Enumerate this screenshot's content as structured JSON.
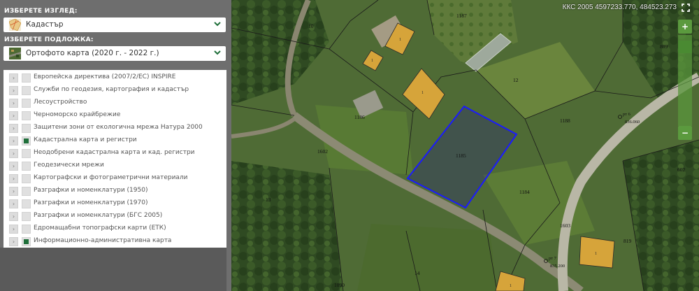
{
  "sidebar": {
    "view_label": "ИЗБЕРЕТЕ ИЗГЛЕД:",
    "view_value": "Кадастър",
    "base_label": "ИЗБЕРЕТЕ ПОДЛОЖКА:",
    "base_value": "Ортофото карта (2020 г. - 2022 г.)",
    "layers": [
      {
        "label": "Европейска директива (2007/2/ЕС) INSPIRE",
        "checked": false
      },
      {
        "label": "Служби по геодезия, картография и кадастър",
        "checked": false
      },
      {
        "label": "Лесоустройство",
        "checked": false
      },
      {
        "label": "Черноморско крайбрежие",
        "checked": false
      },
      {
        "label": "Защитени зони от екологична мрежа Натура 2000",
        "checked": false
      },
      {
        "label": "Кадастрална карта и регистри",
        "checked": true
      },
      {
        "label": "Неодобрени кадастрална карта и кад. регистри",
        "checked": false
      },
      {
        "label": "Геодезически мрежи",
        "checked": false
      },
      {
        "label": "Картографски и фотограметрични материали",
        "checked": false
      },
      {
        "label": "Разграфки и номенклатури (1950)",
        "checked": false
      },
      {
        "label": "Разграфки и номенклатури (1970)",
        "checked": false
      },
      {
        "label": "Разграфки и номенклатури (БГС 2005)",
        "checked": false
      },
      {
        "label": "Едромащабни топографски карти (ЕТК)",
        "checked": false
      },
      {
        "label": "Информационно-административна карта",
        "checked": true
      }
    ]
  },
  "map": {
    "coords": "ККС 2005 4597233.770, 484523.273",
    "zoom_in": "+",
    "zoom_out": "−",
    "parcels": [
      "1187",
      "10",
      "12",
      "1188",
      "809",
      "1186",
      "1602",
      "1185",
      "1184",
      "602",
      "13",
      "1603",
      "819",
      "14",
      "1090"
    ],
    "benchmarks": [
      {
        "id": "рт 6",
        "value": "836.060"
      },
      {
        "id": "рт 7",
        "value": "835.200"
      }
    ],
    "building_labels": [
      "1",
      "1",
      "1",
      "1",
      "1"
    ],
    "accent": "#1f6f3a",
    "parcel_outline": "#1a1aff"
  }
}
